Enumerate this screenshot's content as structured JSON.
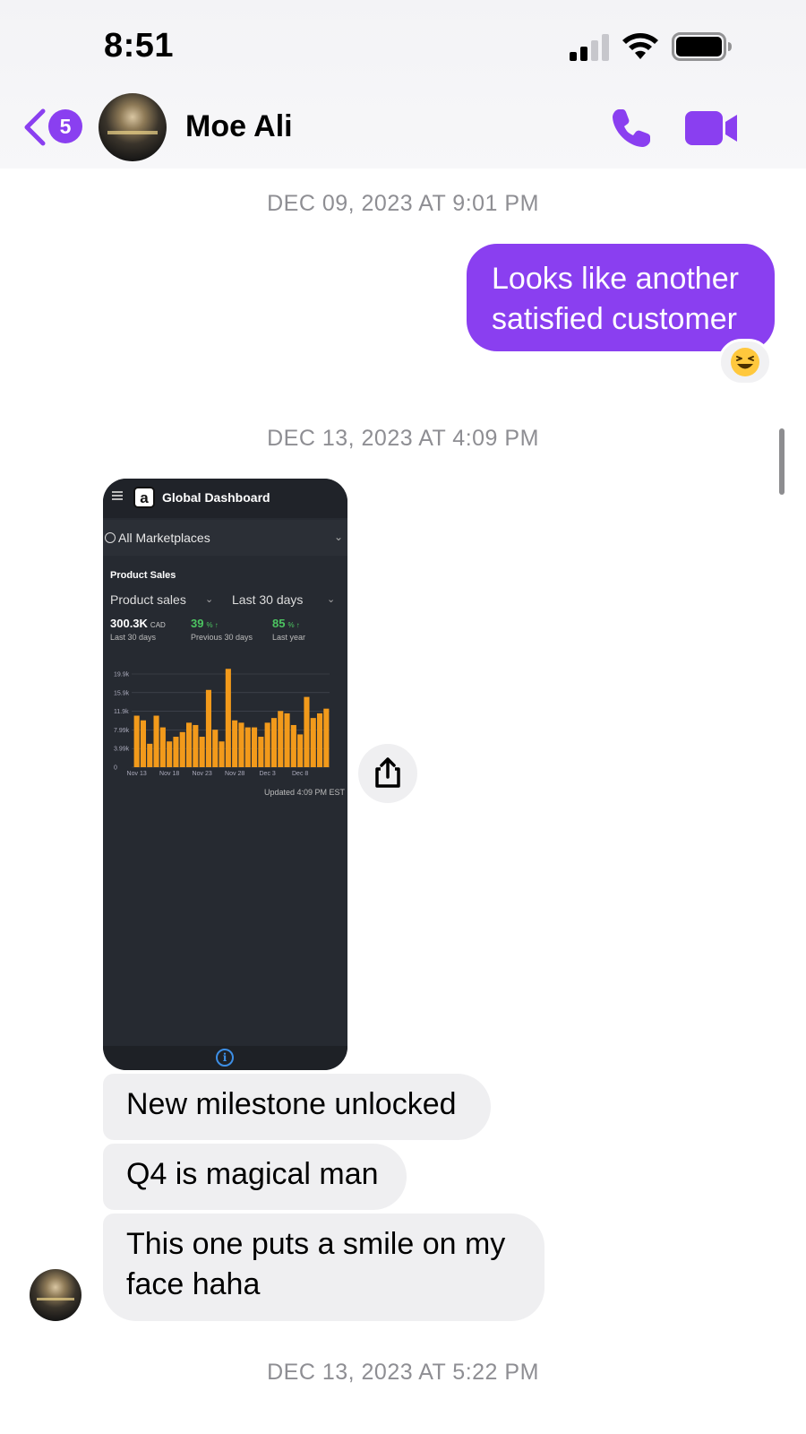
{
  "status_bar": {
    "time": "8:51"
  },
  "header": {
    "back_badge": "5",
    "contact_name": "Moe Ali"
  },
  "timestamps": [
    "DEC 09, 2023 AT 9:01 PM",
    "DEC 13, 2023 AT 4:09 PM",
    "DEC 13, 2023 AT 5:22 PM"
  ],
  "messages": {
    "outgoing_1_line1": "Looks like another",
    "outgoing_1_line2": "satisfied customer",
    "reaction": "😆",
    "incoming_1": "New milestone unlocked",
    "incoming_2": "Q4 is magical man",
    "incoming_3_line1": "This one puts a smile on my",
    "incoming_3_line2": "face haha"
  },
  "attachment": {
    "logo": "a",
    "title": "Global Dashboard",
    "marketplace": "All Marketplaces",
    "section": "Product Sales",
    "metric_select": "Product sales",
    "range_select": "Last 30 days",
    "kpis": [
      {
        "value": "300.3K",
        "unit": "CAD",
        "caption": "Last 30 days",
        "color": "#ffffff"
      },
      {
        "value": "39",
        "unit": "% ↑",
        "caption": "Previous 30 days",
        "color": "#4cc461"
      },
      {
        "value": "85",
        "unit": "% ↑",
        "caption": "Last year",
        "color": "#4cc461"
      }
    ],
    "updated": "Updated 4:09 PM EST",
    "chart_data": {
      "type": "bar",
      "color": "#f29a1b",
      "y_ticks": [
        "19.9k",
        "15.9k",
        "11.9k",
        "7.99k",
        "3.99k",
        "0"
      ],
      "x_ticks": [
        "Nov 13",
        "Nov 18",
        "Nov 23",
        "Nov 28",
        "Dec 3",
        "Dec 8"
      ],
      "ylim": [
        0,
        19900
      ],
      "values": [
        11000,
        10000,
        5000,
        11000,
        8500,
        5500,
        6500,
        7500,
        9500,
        9000,
        6500,
        16500,
        8000,
        5500,
        21000,
        10000,
        9500,
        8500,
        8500,
        6500,
        9500,
        10500,
        12000,
        11500,
        9000,
        7000,
        15000,
        10500,
        11500,
        12500
      ]
    }
  },
  "colors": {
    "accent": "#8a3ff0",
    "incoming_bubble": "#efeff1",
    "timestamp": "#8e8e93"
  }
}
